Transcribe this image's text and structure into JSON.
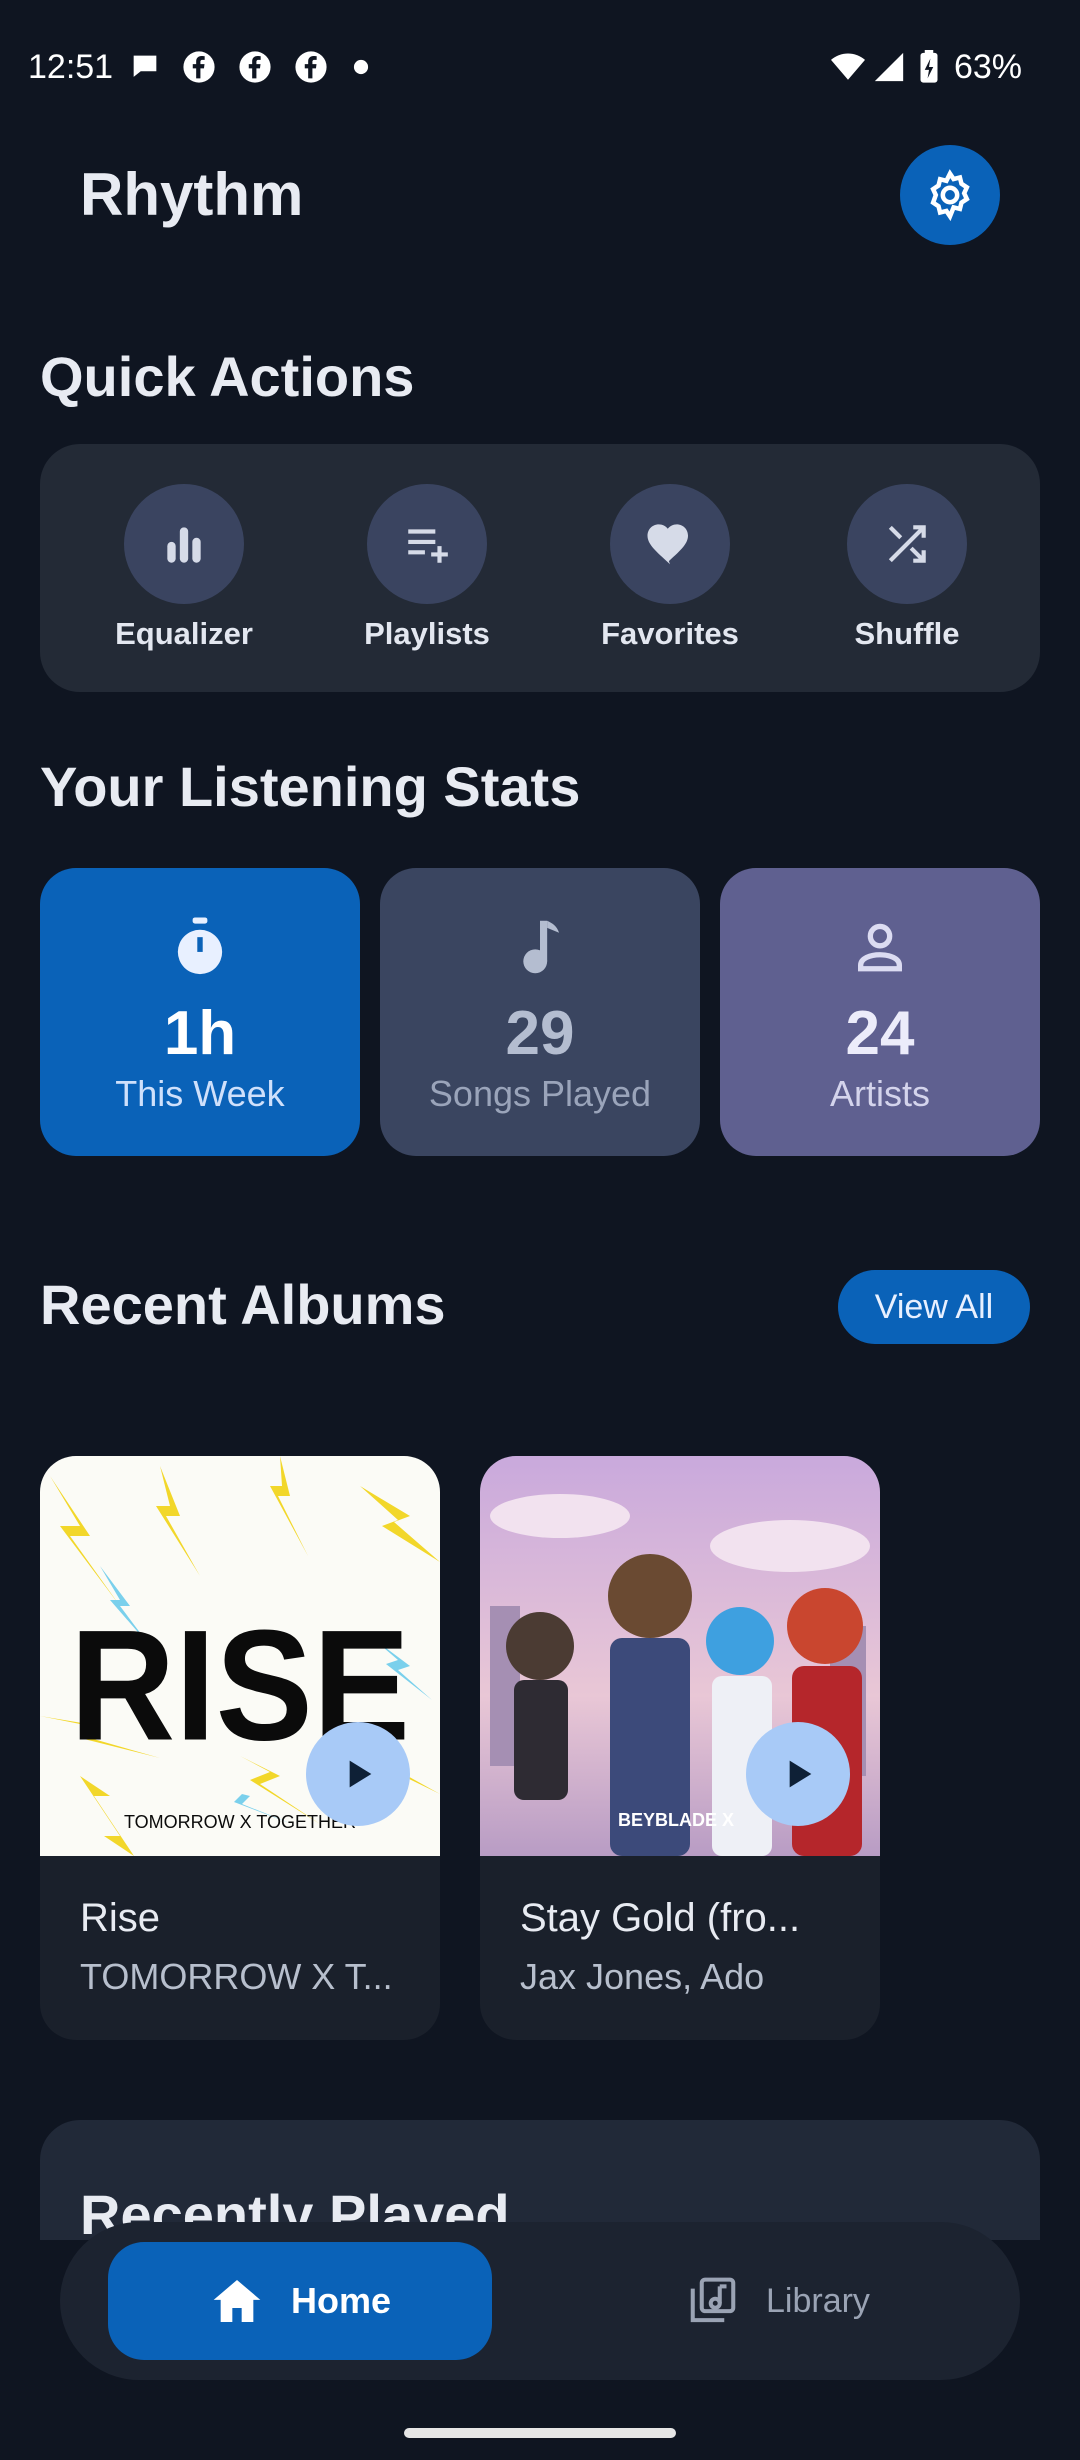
{
  "status_bar": {
    "time": "12:51",
    "battery": "63%"
  },
  "app": {
    "title": "Rhythm"
  },
  "quick_actions": {
    "title": "Quick Actions",
    "items": [
      {
        "label": "Equalizer",
        "icon": "equalizer-icon"
      },
      {
        "label": "Playlists",
        "icon": "playlist-add-icon"
      },
      {
        "label": "Favorites",
        "icon": "heart-icon"
      },
      {
        "label": "Shuffle",
        "icon": "shuffle-icon"
      }
    ]
  },
  "stats": {
    "title": "Your Listening Stats",
    "items": [
      {
        "value": "1h",
        "label": "This Week",
        "icon": "timer-icon",
        "color": "#0a62b8"
      },
      {
        "value": "29",
        "label": "Songs Played",
        "icon": "music-note-icon",
        "color": "#3a4560"
      },
      {
        "value": "24",
        "label": "Artists",
        "icon": "person-icon",
        "color": "#5f6090"
      }
    ]
  },
  "recent_albums": {
    "title": "Recent Albums",
    "view_all_label": "View All",
    "items": [
      {
        "name": "Rise",
        "artist": "TOMORROW X T...",
        "art_text": "RISE",
        "art_subtext": "TOMORROW X TOGETHER"
      },
      {
        "name": "Stay Gold (fro...",
        "artist": "Jax Jones, Ado",
        "art_text": "BEYBLADE X"
      }
    ]
  },
  "recently_played": {
    "title": "Recently Played"
  },
  "nav": {
    "home_label": "Home",
    "library_label": "Library"
  },
  "colors": {
    "accent": "#0a62b8",
    "background": "#0f1521",
    "play_button": "#a8caf7"
  }
}
